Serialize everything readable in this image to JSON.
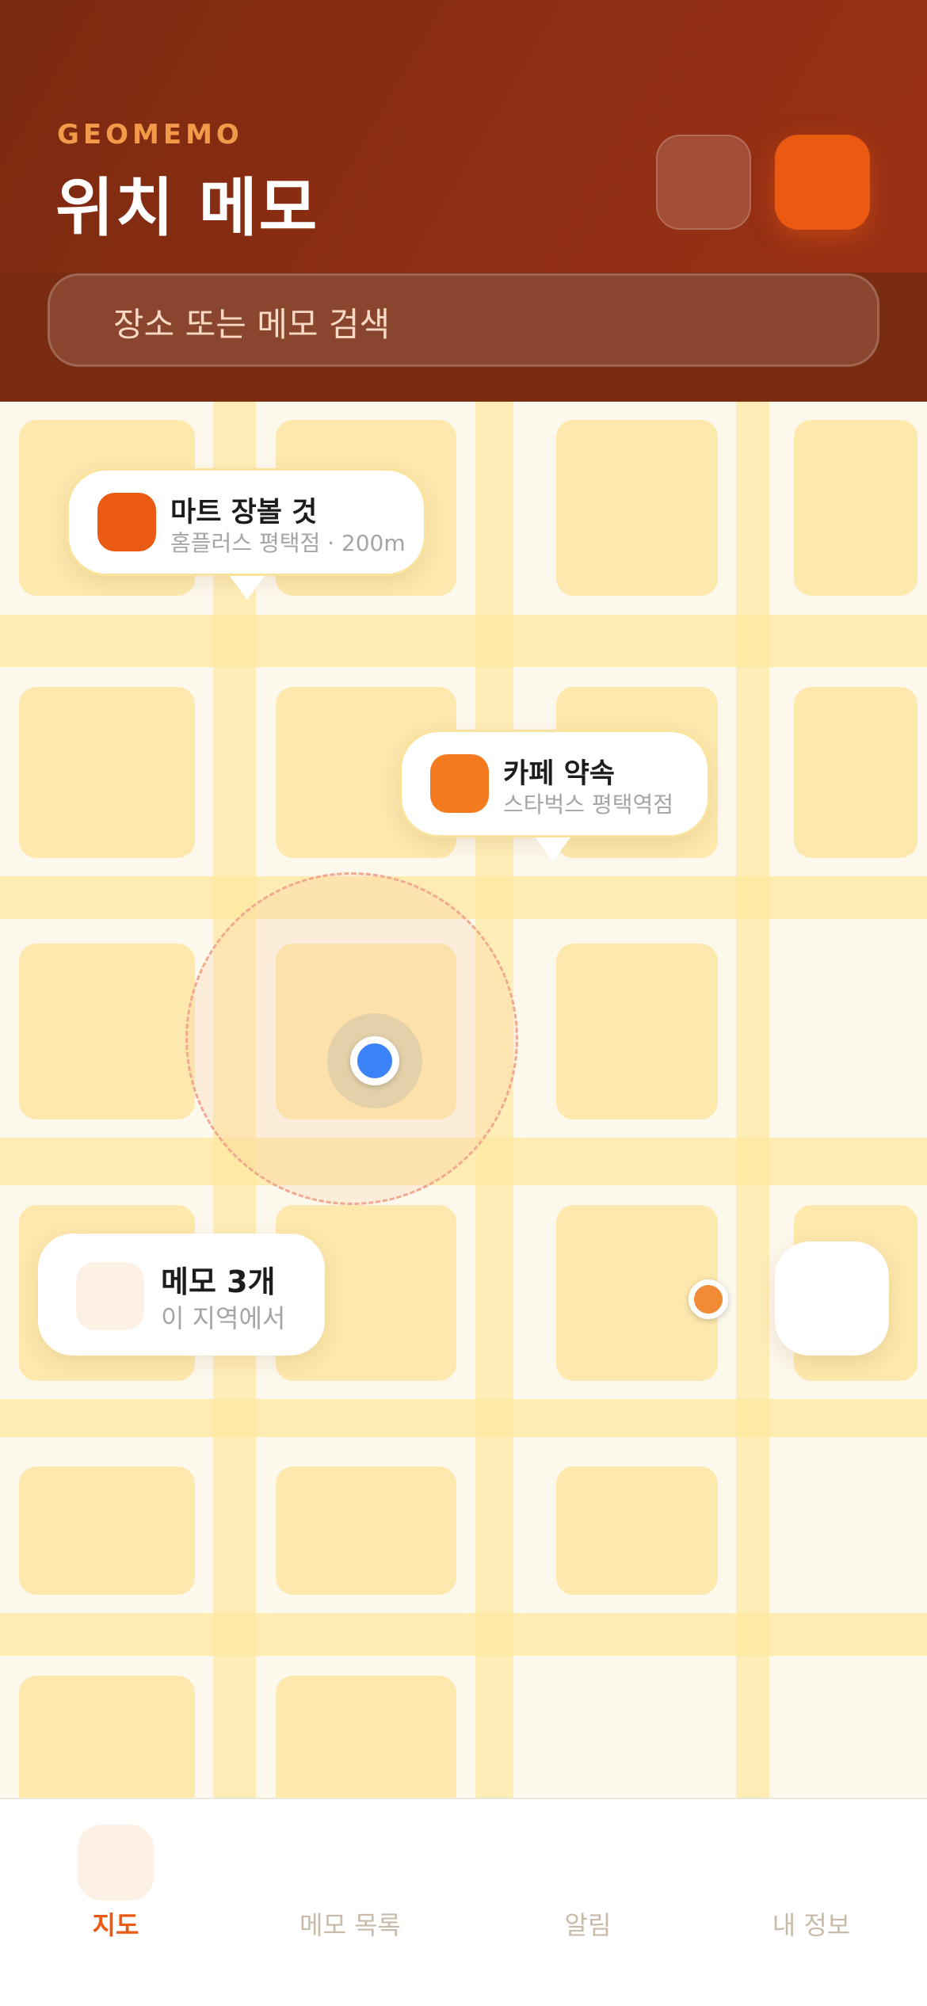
{
  "header": {
    "brand": "GEOMEMO",
    "title": "위치 메모",
    "search_placeholder": "장소 또는 메모 검색"
  },
  "colors": {
    "accent": "#ea5a12",
    "accent_light": "#f28b35",
    "header_bg": "#8e2e13",
    "user_location": "#3b82f6",
    "map_block": "#fde8ad"
  },
  "map": {
    "memos": [
      {
        "title": "마트 장볼 것",
        "subtitle": "홈플러스 평택점 · 200m",
        "icon_color": "#ea5a12"
      },
      {
        "title": "카페 약속",
        "subtitle": "스타벅스 평택역점",
        "icon_color": "#f47a1f"
      }
    ],
    "summary": {
      "title": "메모 3개",
      "subtitle": "이 지역에서"
    }
  },
  "tabs": [
    {
      "label": "지도",
      "active": true
    },
    {
      "label": "메모 목록",
      "active": false
    },
    {
      "label": "알림",
      "active": false
    },
    {
      "label": "내 정보",
      "active": false
    }
  ]
}
